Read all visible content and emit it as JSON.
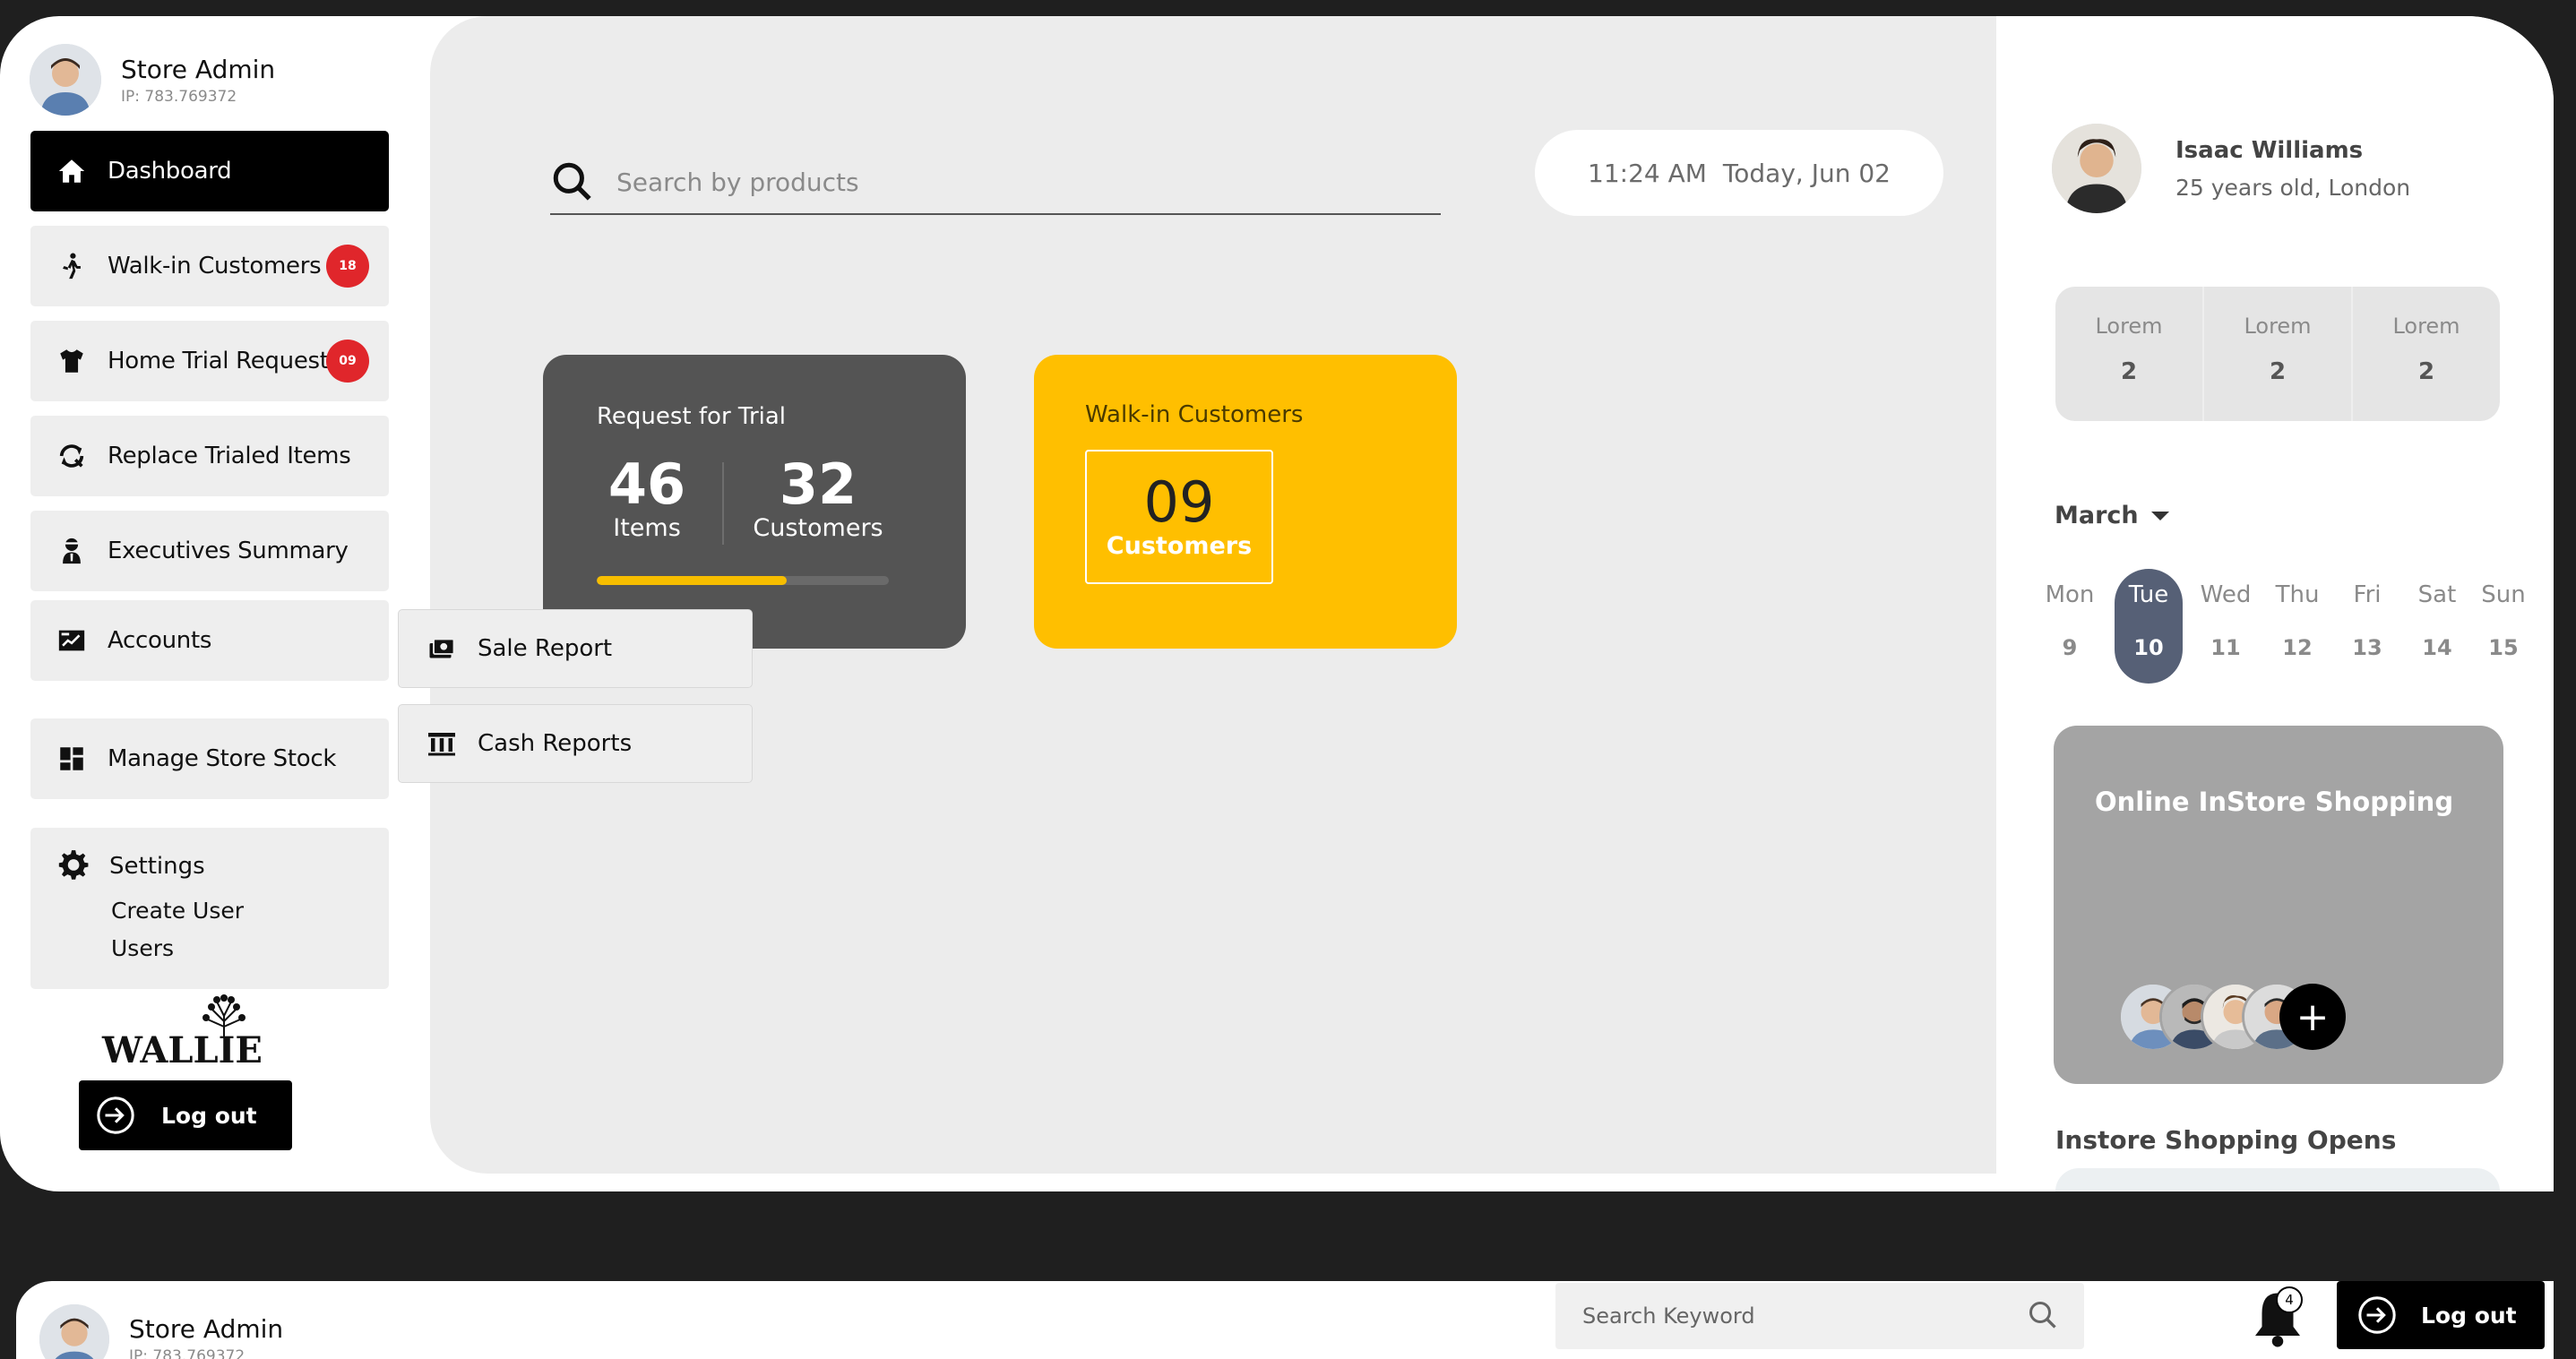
{
  "sidebar": {
    "user": {
      "name": "Store Admin",
      "ip": "IP: 783.769372"
    },
    "nav": [
      {
        "label": "Dashboard",
        "icon": "home-icon",
        "active": true
      },
      {
        "label": "Walk-in Customers",
        "icon": "walking-person-icon",
        "badge": "18"
      },
      {
        "label": "Home Trial Request",
        "icon": "shirt-icon",
        "badge": "09"
      },
      {
        "label": "Replace Trialed Items",
        "icon": "replace-icon"
      },
      {
        "label": "Executives Summary",
        "icon": "executive-icon"
      },
      {
        "label": "Accounts",
        "icon": "accounts-chart-icon"
      },
      {
        "label": "Manage Store Stock",
        "icon": "dashboard-grid-icon"
      }
    ],
    "settings": {
      "label": "Settings",
      "sub": [
        "Create User",
        "Users"
      ]
    },
    "logo_text": "WALLIE",
    "logout_label": "Log out"
  },
  "submenu": [
    {
      "label": "Sale Report",
      "icon": "cash-stack-icon"
    },
    {
      "label": "Cash Reports",
      "icon": "bank-icon"
    }
  ],
  "search": {
    "placeholder": "Search by products"
  },
  "datetime": {
    "time": "11:24 AM",
    "date": "Today, Jun 02"
  },
  "cards": {
    "trial": {
      "title": "Request for Trial",
      "items_value": "46",
      "items_label": "Items",
      "customers_value": "32",
      "customers_label": "Customers",
      "progress": 0.65,
      "accent": "#f7be00"
    },
    "walkin": {
      "title": "Walk-in Customers",
      "value": "09",
      "label": "Customers",
      "color": "#ffbf00"
    }
  },
  "right_panel": {
    "user": {
      "name": "Isaac Williams",
      "subtitle": "25 years old, London"
    },
    "stats": [
      {
        "label": "Lorem",
        "value": "2"
      },
      {
        "label": "Lorem",
        "value": "2"
      },
      {
        "label": "Lorem",
        "value": "2"
      }
    ],
    "month": "March",
    "days": [
      {
        "name": "Mon",
        "date": "9"
      },
      {
        "name": "Tue",
        "date": "10",
        "selected": true
      },
      {
        "name": "Wed",
        "date": "11"
      },
      {
        "name": "Thu",
        "date": "12"
      },
      {
        "name": "Fri",
        "date": "13"
      },
      {
        "name": "Sat",
        "date": "14"
      },
      {
        "name": "Sun",
        "date": "15"
      }
    ],
    "shopping_card": {
      "title": "Online InStore Shopping",
      "add_label": "+"
    },
    "instore_title": "Instore Shopping Opens"
  },
  "bottom_bar": {
    "user": {
      "name": "Store Admin",
      "ip": "IP: 783.769372"
    },
    "search_placeholder": "Search Keyword",
    "notification_count": "4",
    "logout_label": "Log out"
  }
}
